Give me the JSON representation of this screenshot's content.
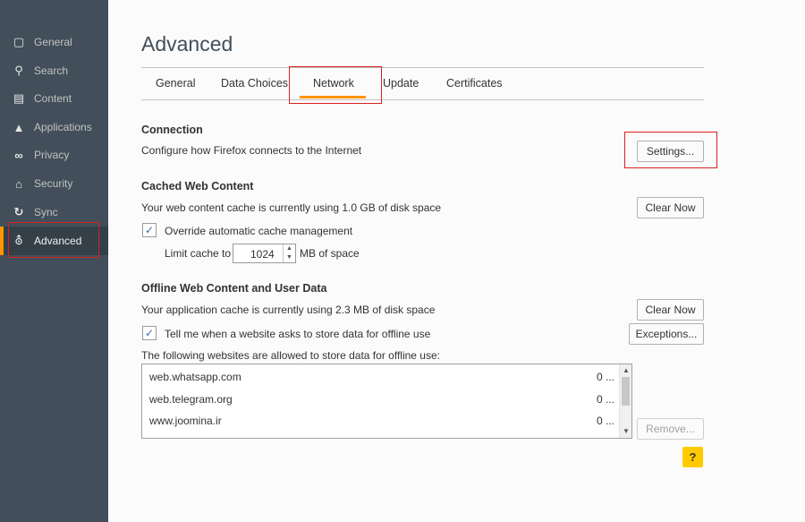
{
  "sidebar": {
    "items": [
      {
        "label": "General",
        "icon": "general-icon",
        "glyph": "▢"
      },
      {
        "label": "Search",
        "icon": "search-icon",
        "glyph": "⚲"
      },
      {
        "label": "Content",
        "icon": "content-icon",
        "glyph": "▤"
      },
      {
        "label": "Applications",
        "icon": "applications-icon",
        "glyph": "▲"
      },
      {
        "label": "Privacy",
        "icon": "privacy-mask-icon",
        "glyph": "∞"
      },
      {
        "label": "Security",
        "icon": "lock-icon",
        "glyph": "⌂"
      },
      {
        "label": "Sync",
        "icon": "sync-icon",
        "glyph": "↻"
      },
      {
        "label": "Advanced",
        "icon": "wizard-hat-icon",
        "glyph": "⛢",
        "active": true
      }
    ]
  },
  "page": {
    "title": "Advanced"
  },
  "tabs": [
    {
      "label": "General"
    },
    {
      "label": "Data Choices"
    },
    {
      "label": "Network",
      "active": true
    },
    {
      "label": "Update"
    },
    {
      "label": "Certificates"
    }
  ],
  "connection": {
    "heading": "Connection",
    "description": "Configure how Firefox connects to the Internet",
    "settings_button": "Settings..."
  },
  "cache": {
    "heading": "Cached Web Content",
    "description": "Your web content cache is currently using 1.0 GB of disk space",
    "clear_button": "Clear Now",
    "override_label": "Override automatic cache management",
    "override_checked": true,
    "limit_label": "Limit cache to",
    "limit_value": "1024",
    "limit_unit": "MB of space"
  },
  "offline": {
    "heading": "Offline Web Content and User Data",
    "description": "Your application cache is currently using 2.3 MB of disk space",
    "clear_button": "Clear Now",
    "tell_label": "Tell me when a website asks to store data for offline use",
    "tell_checked": true,
    "exceptions_button": "Exceptions...",
    "allowed_label": "The following websites are allowed to store data for offline use:",
    "sites": [
      {
        "url": "web.whatsapp.com",
        "usage": "0 ..."
      },
      {
        "url": "web.telegram.org",
        "usage": "0 ..."
      },
      {
        "url": "www.joomina.ir",
        "usage": "0 ..."
      }
    ],
    "remove_button": "Remove..."
  },
  "help": {
    "label": "?"
  },
  "colors": {
    "accent": "#ff9500",
    "highlight_box": "#d92020",
    "sidebar_bg": "#424f5a",
    "help_bg": "#ffcb00"
  }
}
